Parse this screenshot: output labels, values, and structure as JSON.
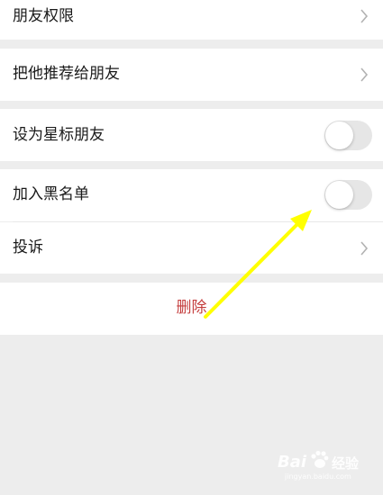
{
  "settings": {
    "items": [
      {
        "label": "朋友权限",
        "control": "chevron"
      },
      {
        "label": "把他推荐给朋友",
        "control": "chevron"
      },
      {
        "label": "设为星标朋友",
        "control": "toggle",
        "on": false
      },
      {
        "label": "加入黑名单",
        "control": "toggle",
        "on": false
      },
      {
        "label": "投诉",
        "control": "chevron"
      }
    ],
    "delete_label": "删除"
  },
  "annotation": {
    "arrow_color": "#ffff00"
  },
  "watermark": {
    "text_latin": "Bai",
    "text_cn": "经验",
    "text_url": "jingyan.baidu.com"
  },
  "colors": {
    "background": "#ededed",
    "delete_text": "#c43d3d",
    "toggle_off": "#e6e6e6"
  }
}
